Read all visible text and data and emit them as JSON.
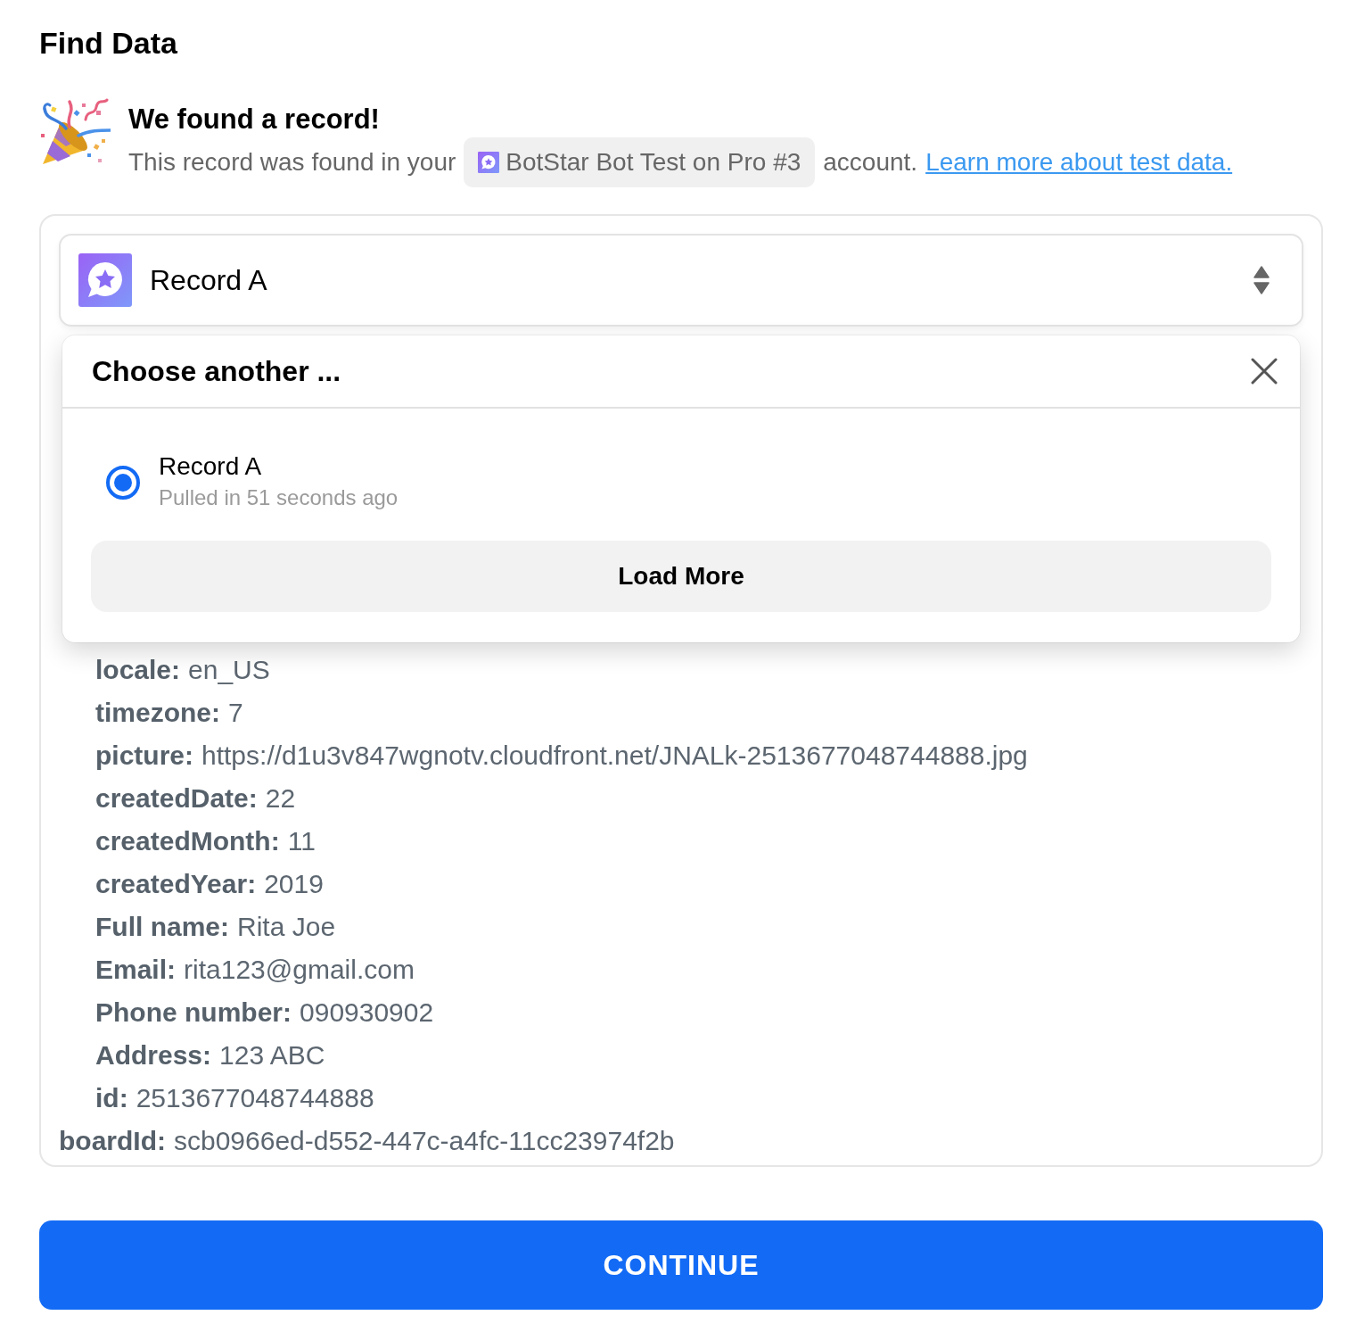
{
  "title": "Find Data",
  "notice": {
    "heading": "We found a record!",
    "text_before": "This record was found in your",
    "account": "BotStar Bot Test on Pro #3",
    "text_after": "account.",
    "link": "Learn more about test data."
  },
  "record_select": {
    "value": "Record A"
  },
  "chooser": {
    "title": "Choose another ...",
    "options": [
      {
        "label": "Record A",
        "detail": "Pulled in 51 seconds ago",
        "selected": true
      }
    ],
    "load_more": "Load More"
  },
  "record_fields": [
    {
      "children": [
        {
          "key": "locale:",
          "value": "en_US"
        },
        {
          "key": "timezone:",
          "value": "7"
        },
        {
          "key": "picture:",
          "value": "https://d1u3v847wgnotv.cloudfront.net/JNALk-2513677048744888.jpg"
        },
        {
          "key": "createdDate:",
          "value": "22"
        },
        {
          "key": "createdMonth:",
          "value": "11"
        },
        {
          "key": "createdYear:",
          "value": "2019"
        },
        {
          "key": "Full name:",
          "value": "Rita Joe"
        },
        {
          "key": "Email:",
          "value": "rita123@gmail.com"
        },
        {
          "key": "Phone number:",
          "value": "090930902"
        },
        {
          "key": "Address:",
          "value": "123 ABC"
        },
        {
          "key": "id:",
          "value": "2513677048744888"
        }
      ]
    },
    {
      "key": "boardId:",
      "value": "scb0966ed-d552-447c-a4fc-11cc23974f2b"
    }
  ],
  "continue_button": "CONTINUE"
}
